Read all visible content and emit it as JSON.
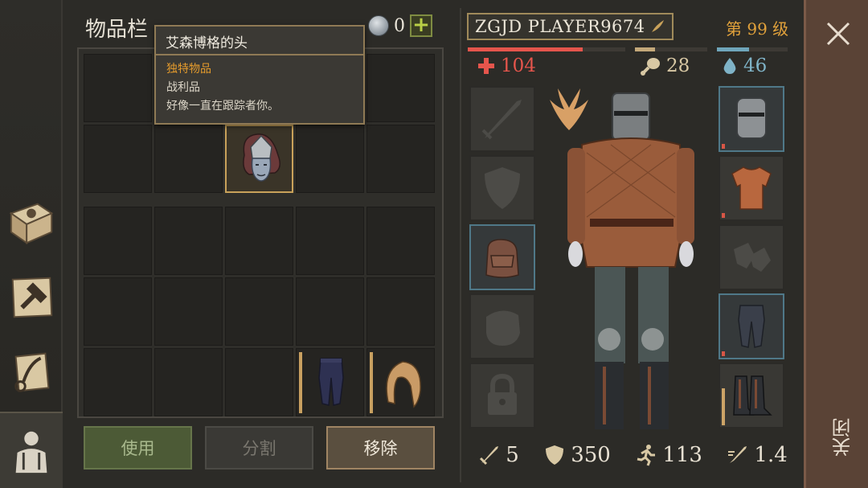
{
  "inventory": {
    "title": "物品栏",
    "currency_count": "0",
    "buttons": {
      "use": "使用",
      "split": "分割",
      "remove": "移除"
    }
  },
  "tooltip": {
    "title": "艾森博格的头",
    "rarity": "独特物品",
    "type": "战利品",
    "description": "好像一直在跟踪者你。"
  },
  "player": {
    "name": "ZGJD PLAYER9674",
    "level_prefix": "第",
    "level_value": "99",
    "level_suffix": "级",
    "health": "104",
    "food": "28",
    "water": "46",
    "health_fraction": 0.73,
    "food_fraction": 0.28,
    "water_fraction": 0.46
  },
  "combat_stats": {
    "attack": "5",
    "armor": "350",
    "speed": "113",
    "attack_speed": "1.4"
  },
  "close": {
    "label": "关闭"
  },
  "colors": {
    "rarity_orange": "#e59b2c",
    "health_red": "#e5554c",
    "water_blue": "#7fb3c7",
    "level_gold": "#e2a23b"
  },
  "icons": {
    "sidebar": [
      "skills-book-icon",
      "crafting-hammer-icon",
      "quests-scroll-icon",
      "character-icon"
    ],
    "equipment_left": [
      "weapon-slot-icon",
      "shield-slot-icon",
      "backpack-icon",
      "bag-slot-icon",
      "lock-icon"
    ],
    "equipment_right": [
      "helmet-icon",
      "chest-armor-icon",
      "gloves-slot-icon",
      "leg-armor-icon",
      "boots-icon"
    ]
  }
}
